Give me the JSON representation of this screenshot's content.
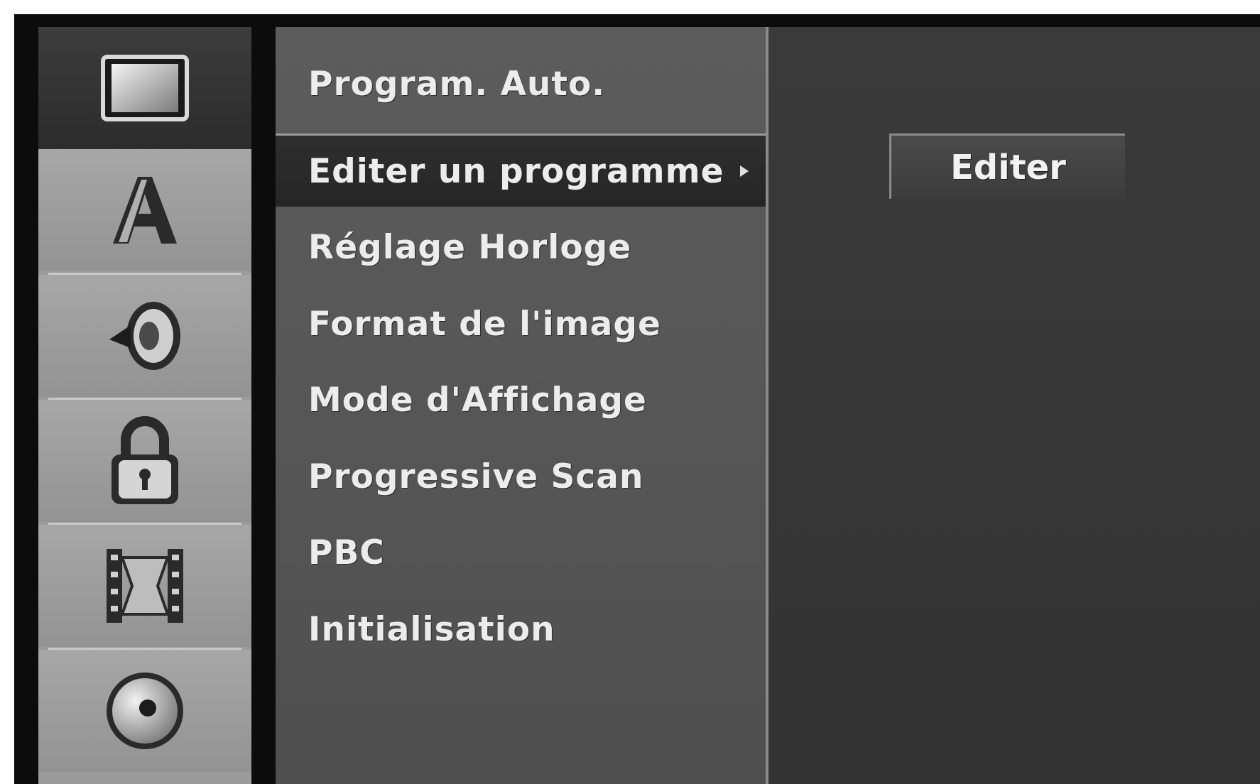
{
  "sidebar": {
    "categories": [
      {
        "icon": "tv-screen-icon",
        "selected": true
      },
      {
        "icon": "language-letter-a-icon",
        "selected": false
      },
      {
        "icon": "audio-speaker-icon",
        "selected": false
      },
      {
        "icon": "padlock-icon",
        "selected": false
      },
      {
        "icon": "film-recording-icon",
        "selected": false
      },
      {
        "icon": "disc-icon",
        "selected": false
      }
    ]
  },
  "menu": {
    "items": [
      {
        "label": "Program. Auto."
      },
      {
        "label": "Editer un programme",
        "selected": true,
        "has_submenu": true
      },
      {
        "label": "Réglage Horloge"
      },
      {
        "label": "Format de l'image"
      },
      {
        "label": "Mode d'Affichage"
      },
      {
        "label": "Progressive Scan"
      },
      {
        "label": "PBC"
      },
      {
        "label": "Initialisation"
      }
    ]
  },
  "panel": {
    "option_label": "Editer"
  },
  "colors": {
    "frame": "#0c0c0c",
    "sidebar": "#9b9b9b",
    "sidebar_selected": "#333333",
    "menu": "#575757",
    "menu_selected": "#2a2a2a",
    "panel": "#363636",
    "text": "#ececec"
  }
}
